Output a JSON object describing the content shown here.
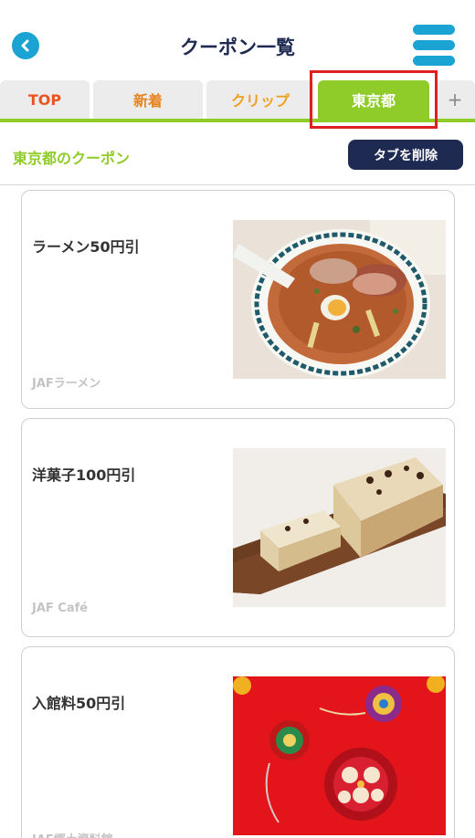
{
  "header": {
    "title": "クーポン一覧"
  },
  "tabs": [
    {
      "label": "TOP"
    },
    {
      "label": "新着"
    },
    {
      "label": "クリップ"
    },
    {
      "label": "東京都",
      "selected": true
    },
    {
      "label": "+"
    }
  ],
  "section": {
    "title": "東京都のクーポン",
    "delete_label": "タブを削除"
  },
  "coupons": [
    {
      "title": "ラーメン50円引",
      "shop": "JAFラーメン",
      "image": "ramen-photo"
    },
    {
      "title": "洋菓子100円引",
      "shop": "JAF Café",
      "image": "pastry-photo"
    },
    {
      "title": "入館料50円引",
      "shop": "JAF郷土資料館",
      "image": "temari-photo"
    }
  ],
  "colors": {
    "accent_green": "#8fcc2a",
    "navy": "#1e2a52",
    "blue": "#1aa3d3",
    "highlight_red": "#e02020"
  }
}
